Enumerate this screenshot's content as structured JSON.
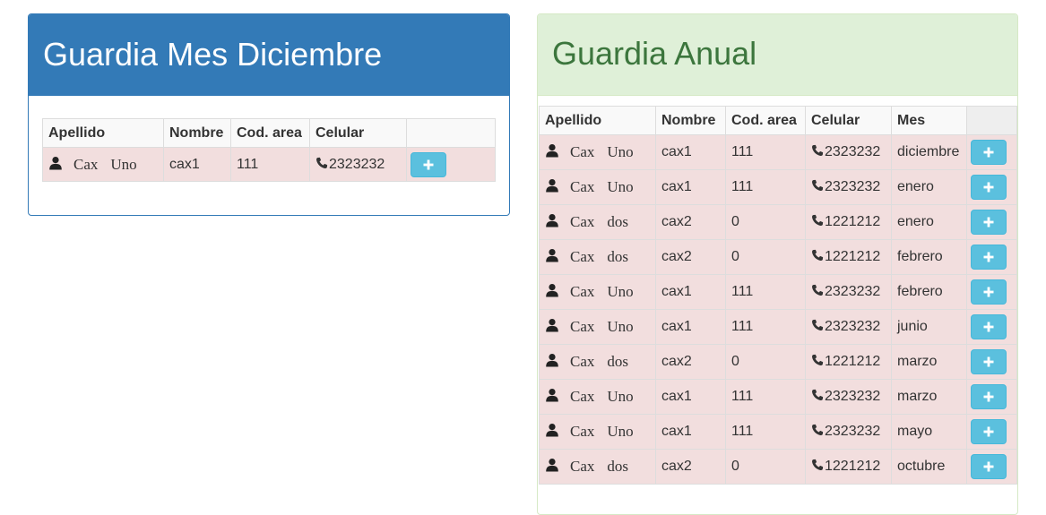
{
  "monthly": {
    "title": "Guardia Mes Diciembre",
    "headers": [
      "Apellido",
      "Nombre",
      "Cod. area",
      "Celular",
      ""
    ],
    "rows": [
      {
        "surname": "Cax",
        "given": "Uno",
        "nombre": "cax1",
        "cod_area": "111",
        "celular": "2323232"
      }
    ]
  },
  "annual": {
    "title": "Guardia Anual",
    "headers": [
      "Apellido",
      "Nombre",
      "Cod. area",
      "Celular",
      "Mes",
      ""
    ],
    "rows": [
      {
        "surname": "Cax",
        "given": "Uno",
        "nombre": "cax1",
        "cod_area": "111",
        "celular": "2323232",
        "mes": "diciembre"
      },
      {
        "surname": "Cax",
        "given": "Uno",
        "nombre": "cax1",
        "cod_area": "111",
        "celular": "2323232",
        "mes": "enero"
      },
      {
        "surname": "Cax",
        "given": "dos",
        "nombre": "cax2",
        "cod_area": "0",
        "celular": "1221212",
        "mes": "enero"
      },
      {
        "surname": "Cax",
        "given": "dos",
        "nombre": "cax2",
        "cod_area": "0",
        "celular": "1221212",
        "mes": "febrero"
      },
      {
        "surname": "Cax",
        "given": "Uno",
        "nombre": "cax1",
        "cod_area": "111",
        "celular": "2323232",
        "mes": "febrero"
      },
      {
        "surname": "Cax",
        "given": "Uno",
        "nombre": "cax1",
        "cod_area": "111",
        "celular": "2323232",
        "mes": "junio"
      },
      {
        "surname": "Cax",
        "given": "dos",
        "nombre": "cax2",
        "cod_area": "0",
        "celular": "1221212",
        "mes": "marzo"
      },
      {
        "surname": "Cax",
        "given": "Uno",
        "nombre": "cax1",
        "cod_area": "111",
        "celular": "2323232",
        "mes": "marzo"
      },
      {
        "surname": "Cax",
        "given": "Uno",
        "nombre": "cax1",
        "cod_area": "111",
        "celular": "2323232",
        "mes": "mayo"
      },
      {
        "surname": "Cax",
        "given": "dos",
        "nombre": "cax2",
        "cod_area": "0",
        "celular": "1221212",
        "mes": "octubre"
      }
    ]
  },
  "icons": {
    "person": "user-icon",
    "phone": "phone-icon",
    "add": "plus-icon"
  },
  "colors": {
    "primary": "#337ab7",
    "success_bg": "#dff0d8",
    "success_text": "#3c763d",
    "danger_row": "#f2dede",
    "info_button": "#5bc0de"
  }
}
